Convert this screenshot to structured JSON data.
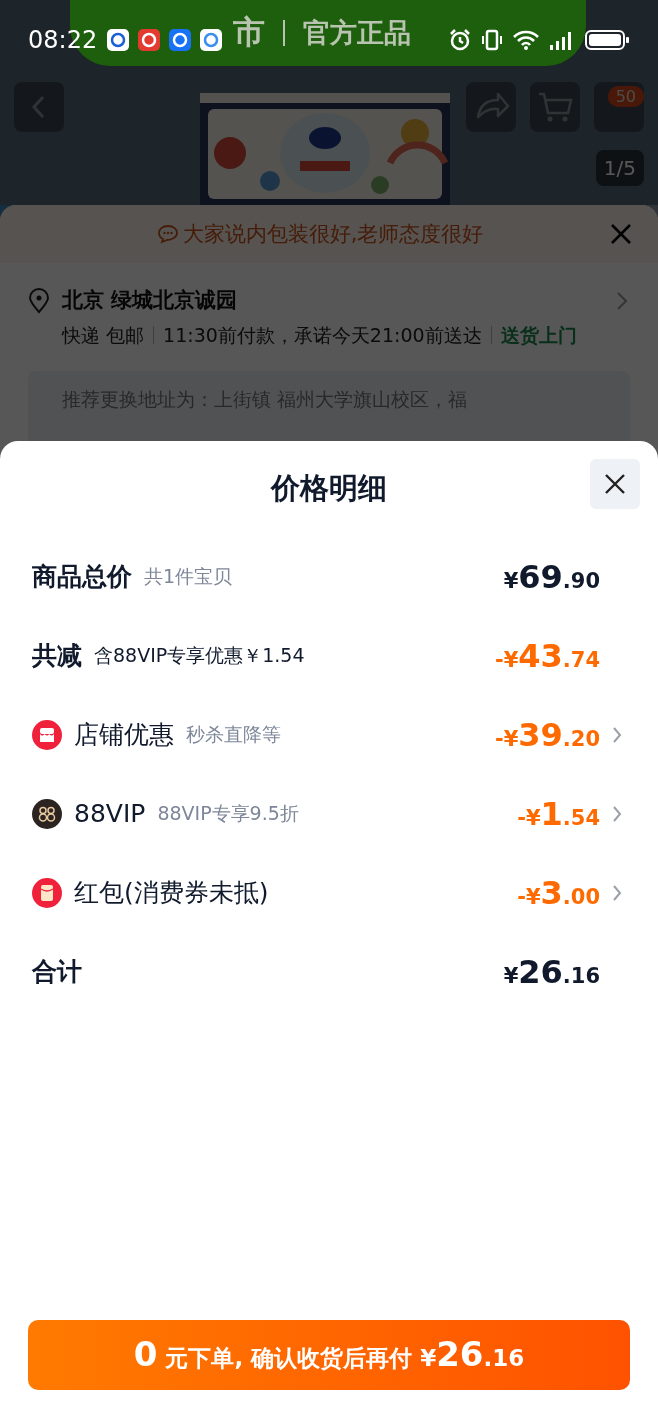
{
  "status_bar": {
    "time": "08:22"
  },
  "banner": {
    "brand": "市",
    "slogan": "官方正品"
  },
  "product_header": {
    "cart_badge": "50",
    "page_indicator": "1/5"
  },
  "tip": {
    "text": "大家说内包装很好,老师态度很好"
  },
  "address": {
    "title": "北京 绿城北京诚园",
    "delivery": [
      "快递 包邮",
      "11:30前付款，承诺今天21:00前送达"
    ],
    "service": "送货上门"
  },
  "recommend": {
    "text": "推荐更换地址为：上街镇 福州大学旗山校区，福"
  },
  "sheet": {
    "title": "价格明细",
    "rows": [
      {
        "kind": "subtotal",
        "label": "商品总价",
        "note": "共1件宝贝",
        "price": {
          "sign": "¥",
          "whole": "69",
          "cents": ".90"
        },
        "chevron": false
      },
      {
        "kind": "reduction",
        "label": "共减",
        "note": "含88VIP专享优惠￥1.54",
        "price": {
          "sign": "-¥",
          "whole": "43",
          "cents": ".74"
        },
        "chevron": false
      },
      {
        "kind": "store",
        "label": "店铺优惠",
        "note": "秒杀直降等",
        "price": {
          "sign": "-¥",
          "whole": "39",
          "cents": ".20"
        },
        "chevron": true
      },
      {
        "kind": "vip",
        "label": "88VIP",
        "note": "88VIP专享9.5折",
        "price": {
          "sign": "-¥",
          "whole": "1",
          "cents": ".54"
        },
        "chevron": true
      },
      {
        "kind": "redpacket",
        "label": "红包(消费券未抵)",
        "price": {
          "sign": "-¥",
          "whole": "3",
          "cents": ".00"
        },
        "chevron": true
      },
      {
        "kind": "total",
        "label": "合计",
        "price": {
          "sign": "¥",
          "whole": "26",
          "cents": ".16"
        },
        "chevron": false
      }
    ],
    "action": [
      {
        "text": "0",
        "emphasized": true
      },
      {
        "text": " 元下单, 确认收货后再付 ¥",
        "emphasized": false
      },
      {
        "text": "26",
        "emphasized": true
      },
      {
        "text": ".16",
        "emphasized": false
      }
    ]
  }
}
